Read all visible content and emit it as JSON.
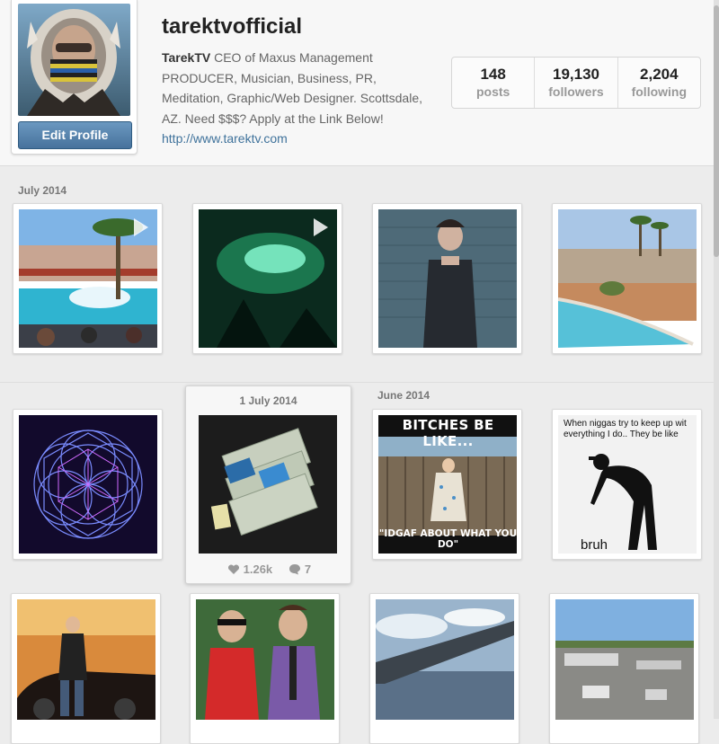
{
  "profile": {
    "username": "tarektvofficial",
    "display_name": "TarekTV",
    "bio": " CEO of Maxus Management PRODUCER, Musician, Business, PR, Meditation, Graphic/Web Designer. Scottsdale, AZ. Need $$$? Apply at the Link Below! ",
    "link": "http://www.tarektv.com",
    "edit_label": "Edit Profile",
    "avatar_icon": "avatar-photo"
  },
  "stats": [
    {
      "value": "148",
      "label": "posts"
    },
    {
      "value": "19,130",
      "label": "followers"
    },
    {
      "value": "2,204",
      "label": "following"
    }
  ],
  "feed": {
    "section_july": "July 2014",
    "section_june": "June 2014",
    "hover": {
      "date": "1 July 2014",
      "likes": "1.26k",
      "comments": "7"
    },
    "meme1": {
      "top": "BITCHES BE LIKE...",
      "bottom": "\"IDGAF ABOUT WHAT YOU DO\""
    },
    "meme2": {
      "text": "When niggas try to keep up wit everything I do.. They be like",
      "caption": "bruh"
    }
  },
  "colors": {
    "accent": "#3f729b",
    "button": "#517fa4"
  }
}
